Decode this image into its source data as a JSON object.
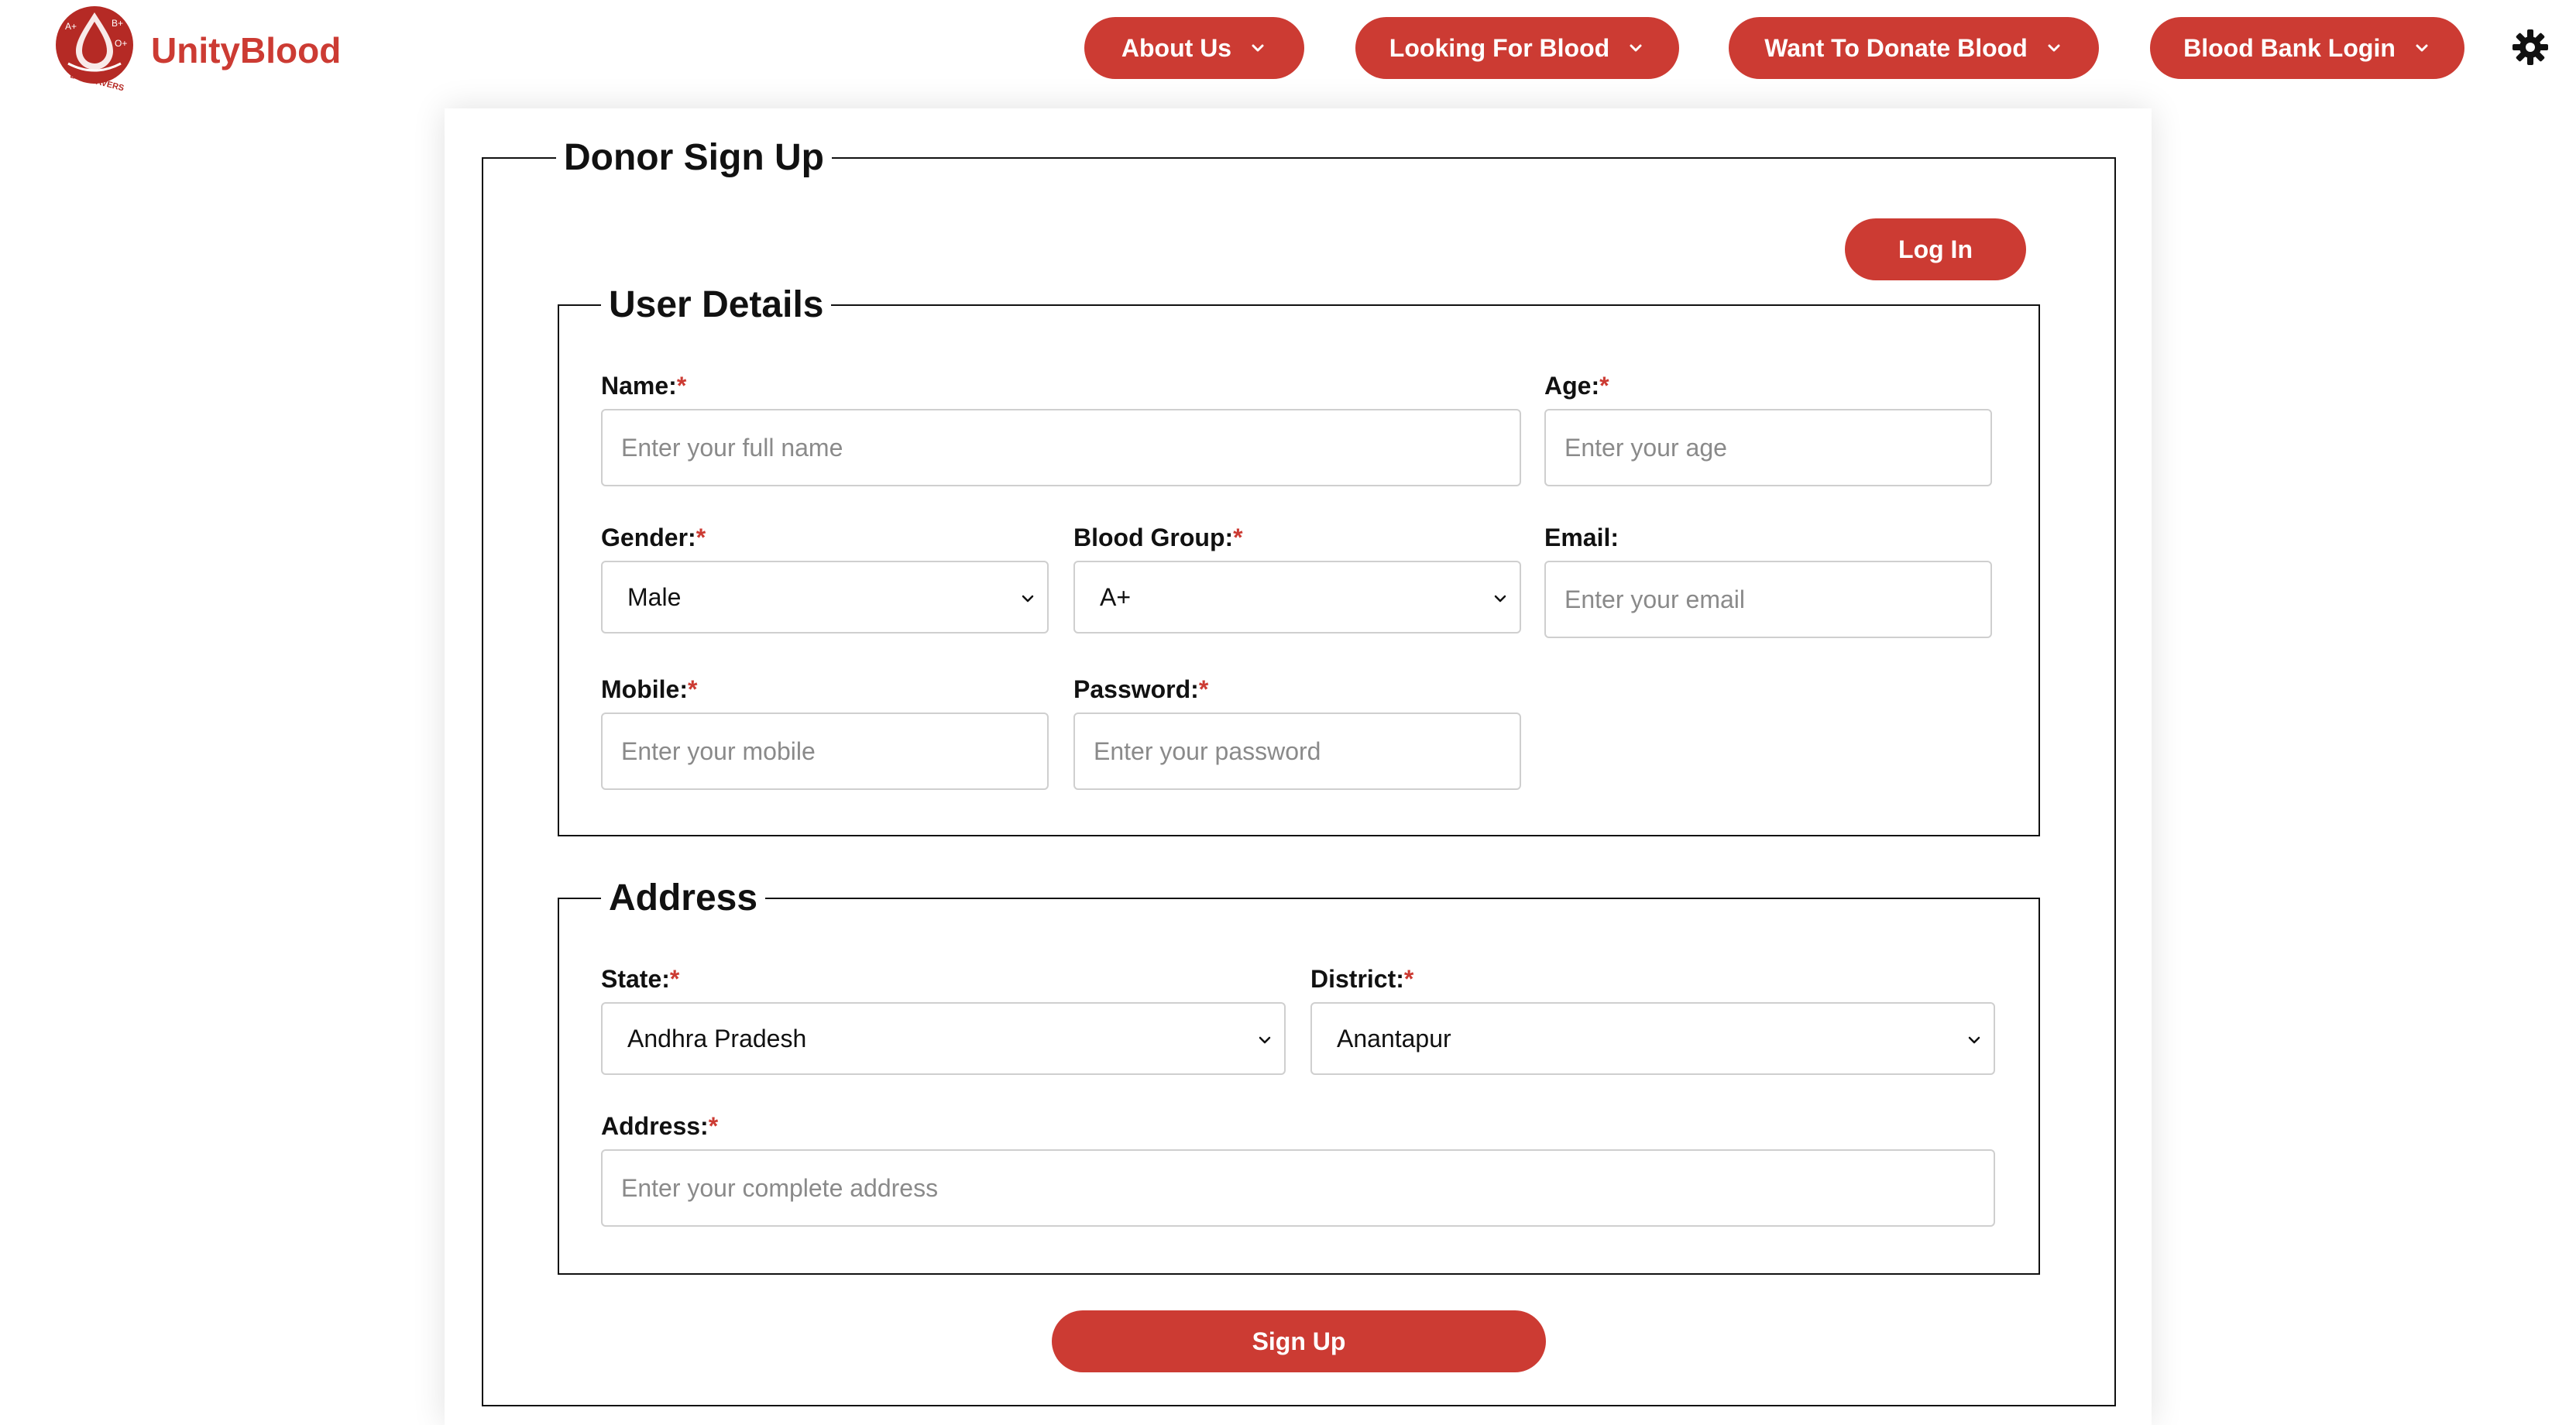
{
  "brand": {
    "name": "UnityBlood",
    "logo_text": [
      "A+",
      "B+",
      "O+",
      "LIFE SAVERS"
    ],
    "color": "#cc3b33"
  },
  "nav": {
    "items": [
      {
        "label": "About Us"
      },
      {
        "label": "Looking For Blood"
      },
      {
        "label": "Want To Donate Blood"
      },
      {
        "label": "Blood Bank Login"
      }
    ],
    "theme_icon": "gear-icon"
  },
  "form": {
    "title": "Donor Sign Up",
    "login_label": "Log In",
    "signup_label": "Sign Up",
    "user_section": {
      "title": "User Details",
      "name": {
        "label": "Name:",
        "placeholder": "Enter your full name"
      },
      "age": {
        "label": "Age:",
        "placeholder": "Enter your age"
      },
      "gender": {
        "label": "Gender:",
        "value": "Male"
      },
      "blood_group": {
        "label": "Blood Group:",
        "value": "A+"
      },
      "email": {
        "label": "Email:",
        "placeholder": "Enter your email"
      },
      "mobile": {
        "label": "Mobile:",
        "placeholder": "Enter your mobile"
      },
      "password": {
        "label": "Password:",
        "placeholder": "Enter your password"
      }
    },
    "address_section": {
      "title": "Address",
      "state": {
        "label": "State:",
        "value": "Andhra Pradesh"
      },
      "district": {
        "label": "District:",
        "value": "Anantapur"
      },
      "address": {
        "label": "Address:",
        "placeholder": "Enter your complete address"
      }
    },
    "required_mark": "*"
  }
}
